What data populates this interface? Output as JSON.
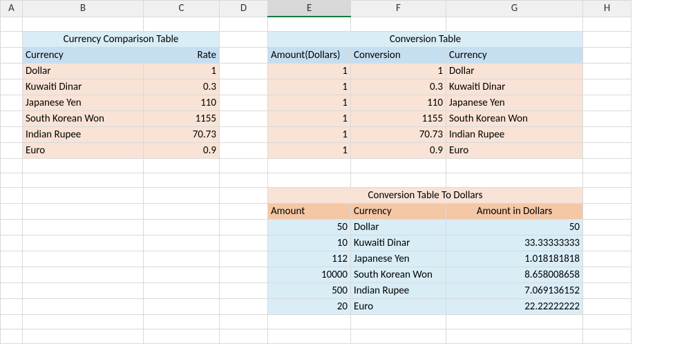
{
  "columns": {
    "A": "A",
    "B": "B",
    "C": "C",
    "D": "D",
    "E": "E",
    "F": "F",
    "G": "G",
    "H": "H"
  },
  "table1": {
    "title": "Currency Comparison Table",
    "col1": "Currency",
    "col2": "Rate",
    "rows": [
      {
        "currency": "Dollar",
        "rate": "1"
      },
      {
        "currency": "Kuwaiti Dinar",
        "rate": "0.3"
      },
      {
        "currency": "Japanese Yen",
        "rate": "110"
      },
      {
        "currency": "South Korean Won",
        "rate": "1155"
      },
      {
        "currency": "Indian Rupee",
        "rate": "70.73"
      },
      {
        "currency": "Euro",
        "rate": "0.9"
      }
    ]
  },
  "table2": {
    "title": "Conversion Table",
    "col1": "Amount(Dollars)",
    "col2": "Conversion",
    "col3": "Currency",
    "rows": [
      {
        "amount": "1",
        "conv": "1",
        "currency": "Dollar"
      },
      {
        "amount": "1",
        "conv": "0.3",
        "currency": "Kuwaiti Dinar"
      },
      {
        "amount": "1",
        "conv": "110",
        "currency": "Japanese Yen"
      },
      {
        "amount": "1",
        "conv": "1155",
        "currency": "South Korean Won"
      },
      {
        "amount": "1",
        "conv": "70.73",
        "currency": "Indian Rupee"
      },
      {
        "amount": "1",
        "conv": "0.9",
        "currency": "Euro"
      }
    ]
  },
  "table3": {
    "title": "Conversion Table To Dollars",
    "col1": "Amount",
    "col2": "Currency",
    "col3": "Amount in Dollars",
    "rows": [
      {
        "amount": "50",
        "currency": "Dollar",
        "dollars": "50"
      },
      {
        "amount": "10",
        "currency": "Kuwaiti Dinar",
        "dollars": "33.33333333"
      },
      {
        "amount": "112",
        "currency": "Japanese Yen",
        "dollars": "1.018181818"
      },
      {
        "amount": "10000",
        "currency": "South Korean Won",
        "dollars": "8.658008658"
      },
      {
        "amount": "500",
        "currency": "Indian Rupee",
        "dollars": "7.069136152"
      },
      {
        "amount": "20",
        "currency": "Euro",
        "dollars": "22.22222222"
      }
    ]
  },
  "chart_data": [
    {
      "type": "table",
      "title": "Currency Comparison Table",
      "columns": [
        "Currency",
        "Rate"
      ],
      "rows": [
        [
          "Dollar",
          1
        ],
        [
          "Kuwaiti Dinar",
          0.3
        ],
        [
          "Japanese Yen",
          110
        ],
        [
          "South Korean Won",
          1155
        ],
        [
          "Indian Rupee",
          70.73
        ],
        [
          "Euro",
          0.9
        ]
      ]
    },
    {
      "type": "table",
      "title": "Conversion Table",
      "columns": [
        "Amount(Dollars)",
        "Conversion",
        "Currency"
      ],
      "rows": [
        [
          1,
          1,
          "Dollar"
        ],
        [
          1,
          0.3,
          "Kuwaiti Dinar"
        ],
        [
          1,
          110,
          "Japanese Yen"
        ],
        [
          1,
          1155,
          "South Korean Won"
        ],
        [
          1,
          70.73,
          "Indian Rupee"
        ],
        [
          1,
          0.9,
          "Euro"
        ]
      ]
    },
    {
      "type": "table",
      "title": "Conversion Table To Dollars",
      "columns": [
        "Amount",
        "Currency",
        "Amount in Dollars"
      ],
      "rows": [
        [
          50,
          "Dollar",
          50
        ],
        [
          10,
          "Kuwaiti Dinar",
          33.33333333
        ],
        [
          112,
          "Japanese Yen",
          1.018181818
        ],
        [
          10000,
          "South Korean Won",
          8.658008658
        ],
        [
          500,
          "Indian Rupee",
          7.069136152
        ],
        [
          20,
          "Euro",
          22.22222222
        ]
      ]
    }
  ]
}
